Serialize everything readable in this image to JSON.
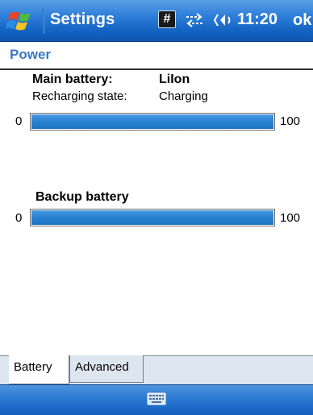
{
  "titlebar": {
    "app_title": "Settings",
    "hash_indicator": "#",
    "time": "11:20",
    "ok_label": "ok"
  },
  "page": {
    "title": "Power"
  },
  "main_battery": {
    "label": "Main battery:",
    "type": "LiIon",
    "recharging_label": "Recharging state:",
    "recharging_value": "Charging",
    "scale_min": "0",
    "scale_max": "100",
    "level_percent": 100
  },
  "backup_battery": {
    "label": "Backup battery",
    "scale_min": "0",
    "scale_max": "100",
    "level_percent": 100
  },
  "tabs": [
    {
      "label": "Battery",
      "active": true
    },
    {
      "label": "Advanced",
      "active": false
    }
  ],
  "colors": {
    "accent": "#2a82d3",
    "title_bar": "#1565c4",
    "page_title": "#3a78c2"
  },
  "icons": {
    "start": "windows-start-icon",
    "connectivity": "sync-arrows-icon",
    "volume": "speaker-icon",
    "keyboard": "keyboard-icon"
  }
}
